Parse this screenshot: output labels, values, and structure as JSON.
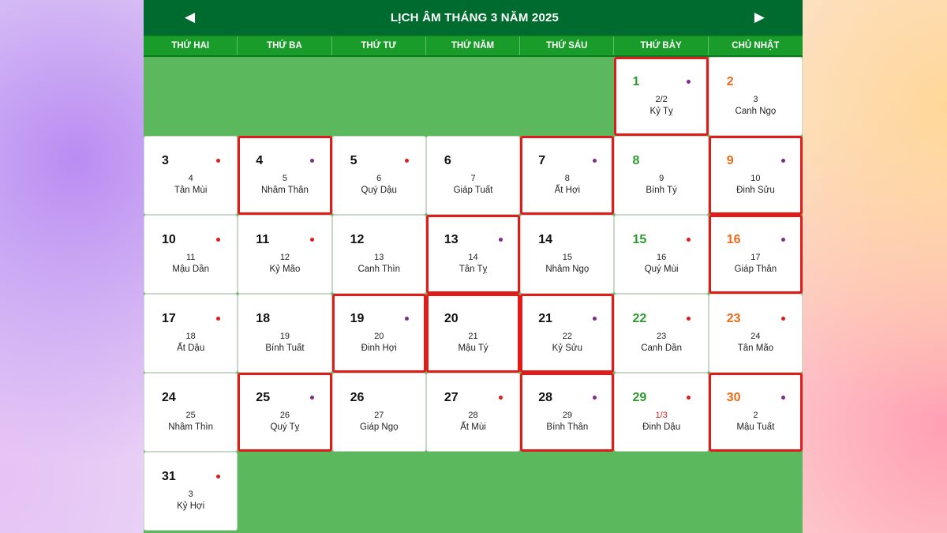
{
  "calendar": {
    "title": "LỊCH ÂM THÁNG 3 NĂM 2025",
    "prev_icon": "◀",
    "next_icon": "▶",
    "weekdays": [
      "THỨ HAI",
      "THỨ BA",
      "THỨ TƯ",
      "THỨ NĂM",
      "THỨ SÁU",
      "THỨ BẢY",
      "CHỦ NHẬT"
    ],
    "leading_blanks": 5,
    "days": [
      {
        "solar": "1",
        "lunar": "2/2",
        "canchi": "Kỷ Tỵ",
        "dot": "purple",
        "highlight": true
      },
      {
        "solar": "2",
        "lunar": "3",
        "canchi": "Canh Ngọ",
        "dot": null,
        "highlight": false
      },
      {
        "solar": "3",
        "lunar": "4",
        "canchi": "Tân Mùi",
        "dot": "red",
        "highlight": false
      },
      {
        "solar": "4",
        "lunar": "5",
        "canchi": "Nhâm Thân",
        "dot": "purple",
        "highlight": true
      },
      {
        "solar": "5",
        "lunar": "6",
        "canchi": "Quý Dậu",
        "dot": "red",
        "highlight": false
      },
      {
        "solar": "6",
        "lunar": "7",
        "canchi": "Giáp Tuất",
        "dot": null,
        "highlight": false
      },
      {
        "solar": "7",
        "lunar": "8",
        "canchi": "Ất Hợi",
        "dot": "purple",
        "highlight": true
      },
      {
        "solar": "8",
        "lunar": "9",
        "canchi": "Bính Tý",
        "dot": null,
        "highlight": false
      },
      {
        "solar": "9",
        "lunar": "10",
        "canchi": "Đinh Sửu",
        "dot": "purple",
        "highlight": true
      },
      {
        "solar": "10",
        "lunar": "11",
        "canchi": "Mậu Dần",
        "dot": "red",
        "highlight": false
      },
      {
        "solar": "11",
        "lunar": "12",
        "canchi": "Kỷ Mão",
        "dot": "red",
        "highlight": false
      },
      {
        "solar": "12",
        "lunar": "13",
        "canchi": "Canh Thìn",
        "dot": null,
        "highlight": false
      },
      {
        "solar": "13",
        "lunar": "14",
        "canchi": "Tân Tỵ",
        "dot": "purple",
        "highlight": true
      },
      {
        "solar": "14",
        "lunar": "15",
        "canchi": "Nhâm Ngọ",
        "dot": null,
        "highlight": false
      },
      {
        "solar": "15",
        "lunar": "16",
        "canchi": "Quý Mùi",
        "dot": "red",
        "highlight": false
      },
      {
        "solar": "16",
        "lunar": "17",
        "canchi": "Giáp Thân",
        "dot": "purple",
        "highlight": true
      },
      {
        "solar": "17",
        "lunar": "18",
        "canchi": "Ất Dậu",
        "dot": "red",
        "highlight": false
      },
      {
        "solar": "18",
        "lunar": "19",
        "canchi": "Bính Tuất",
        "dot": null,
        "highlight": false
      },
      {
        "solar": "19",
        "lunar": "20",
        "canchi": "Đinh Hợi",
        "dot": "purple",
        "highlight": true
      },
      {
        "solar": "20",
        "lunar": "21",
        "canchi": "Mậu Tý",
        "dot": null,
        "highlight": true
      },
      {
        "solar": "21",
        "lunar": "22",
        "canchi": "Kỷ Sửu",
        "dot": "purple",
        "highlight": true
      },
      {
        "solar": "22",
        "lunar": "23",
        "canchi": "Canh Dần",
        "dot": "red",
        "highlight": false
      },
      {
        "solar": "23",
        "lunar": "24",
        "canchi": "Tân Mão",
        "dot": "red",
        "highlight": false
      },
      {
        "solar": "24",
        "lunar": "25",
        "canchi": "Nhâm Thìn",
        "dot": null,
        "highlight": false
      },
      {
        "solar": "25",
        "lunar": "26",
        "canchi": "Quý Tỵ",
        "dot": "purple",
        "highlight": true
      },
      {
        "solar": "26",
        "lunar": "27",
        "canchi": "Giáp Ngọ",
        "dot": null,
        "highlight": false
      },
      {
        "solar": "27",
        "lunar": "28",
        "canchi": "Ất Mùi",
        "dot": "red",
        "highlight": false
      },
      {
        "solar": "28",
        "lunar": "29",
        "canchi": "Bính Thân",
        "dot": "purple",
        "highlight": true
      },
      {
        "solar": "29",
        "lunar": "1/3",
        "canchi": "Đinh Dậu",
        "dot": "red",
        "highlight": false,
        "lunar_mark": true
      },
      {
        "solar": "30",
        "lunar": "2",
        "canchi": "Mậu Tuất",
        "dot": "purple",
        "highlight": true
      },
      {
        "solar": "31",
        "lunar": "3",
        "canchi": "Kỷ Hợi",
        "dot": "red",
        "highlight": false
      }
    ],
    "trailing_blanks": 6
  },
  "colors": {
    "header_bg": "#006b2e",
    "weekday_bg": "#1a9c2a",
    "grid_bg": "#5cb85c",
    "saturday": "#2e9b2e",
    "sunday": "#ee6a1a",
    "highlight": "#e11a1a",
    "dot_red": "#e21b1b",
    "dot_purple": "#7f2b8c"
  }
}
